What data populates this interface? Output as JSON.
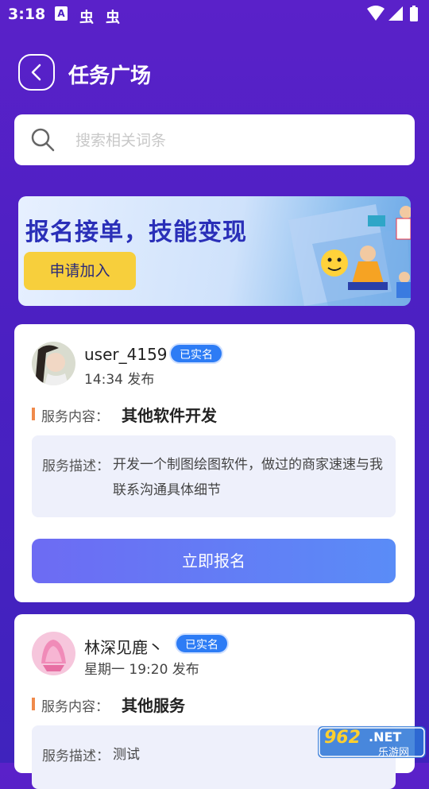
{
  "status_bar": {
    "time": "3:18",
    "notif_a": "A",
    "notif_1": "虫",
    "notif_2": "虫"
  },
  "header": {
    "title": "任务广场"
  },
  "search": {
    "placeholder": "搜索相关词条",
    "value": ""
  },
  "banner": {
    "title": "报名接单，技能变现",
    "button_label": "申请加入"
  },
  "tasks": [
    {
      "user": "user_4159",
      "badge": "已实名",
      "time": "14:34 发布",
      "service_label": "服务内容：",
      "service_value": "其他软件开发",
      "desc_label": "服务描述：",
      "desc_text": "开发一个制图绘图软件，做过的商家速速与我联系沟通具体细节",
      "button_label": "立即报名"
    },
    {
      "user": "林深见鹿丶",
      "badge": "已实名",
      "time": "星期一 19:20 发布",
      "service_label": "服务内容：",
      "service_value": "其他服务",
      "desc_label": "服务描述：",
      "desc_text": "测试"
    }
  ],
  "watermark": {
    "brand": "962",
    "suffix": ".NET",
    "sub": "乐游网"
  },
  "colors": {
    "background": "#4b20c2",
    "accent": "#5a8cf7",
    "badge": "#2d7cf5",
    "banner_button": "#f7cf3c"
  }
}
